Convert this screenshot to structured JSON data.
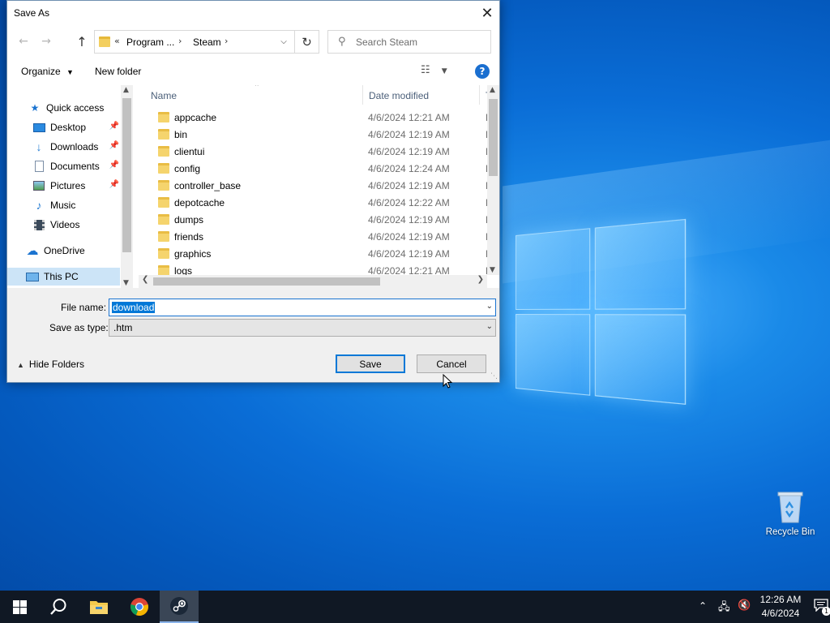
{
  "dialog": {
    "title": "Save As",
    "close_glyph": "✕",
    "address": {
      "overflow": "«",
      "crumbs": [
        "Program ...",
        "Steam"
      ]
    },
    "search": {
      "placeholder": "Search Steam"
    },
    "toolbar": {
      "organize": "Organize",
      "new_folder": "New folder",
      "help": "?"
    },
    "nav_pane": {
      "items": [
        {
          "label": "Quick access",
          "icon": "star-icon"
        },
        {
          "label": "Desktop",
          "icon": "desktop-icon",
          "pinned": true
        },
        {
          "label": "Downloads",
          "icon": "download-icon",
          "pinned": true
        },
        {
          "label": "Documents",
          "icon": "document-icon",
          "pinned": true
        },
        {
          "label": "Pictures",
          "icon": "picture-icon",
          "pinned": true
        },
        {
          "label": "Music",
          "icon": "music-icon"
        },
        {
          "label": "Videos",
          "icon": "video-icon"
        },
        {
          "label": "OneDrive",
          "icon": "cloud-icon"
        },
        {
          "label": "This PC",
          "icon": "computer-icon",
          "selected": true
        }
      ]
    },
    "file_list": {
      "columns": [
        "Name",
        "Date modified",
        "Ty"
      ],
      "rows": [
        {
          "name": "appcache",
          "date": "4/6/2024 12:21 AM",
          "type": "Fi"
        },
        {
          "name": "bin",
          "date": "4/6/2024 12:19 AM",
          "type": "Fi"
        },
        {
          "name": "clientui",
          "date": "4/6/2024 12:19 AM",
          "type": "Fi"
        },
        {
          "name": "config",
          "date": "4/6/2024 12:24 AM",
          "type": "Fi"
        },
        {
          "name": "controller_base",
          "date": "4/6/2024 12:19 AM",
          "type": "Fi"
        },
        {
          "name": "depotcache",
          "date": "4/6/2024 12:22 AM",
          "type": "Fi"
        },
        {
          "name": "dumps",
          "date": "4/6/2024 12:19 AM",
          "type": "Fi"
        },
        {
          "name": "friends",
          "date": "4/6/2024 12:19 AM",
          "type": "Fi"
        },
        {
          "name": "graphics",
          "date": "4/6/2024 12:19 AM",
          "type": "Fi"
        },
        {
          "name": "logs",
          "date": "4/6/2024 12:21 AM",
          "type": "Fi"
        }
      ]
    },
    "form": {
      "file_name_label": "File name:",
      "file_name_value": "download",
      "save_type_label": "Save as type:",
      "save_type_value": ".htm"
    },
    "hide_folders": "Hide Folders",
    "save": "Save",
    "cancel": "Cancel"
  },
  "desktop": {
    "recycle_bin": "Recycle Bin"
  },
  "taskbar": {
    "apps": [
      "start",
      "search",
      "file-explorer",
      "chrome",
      "steam"
    ],
    "active_app": "steam",
    "clock_time": "12:26 AM",
    "clock_date": "4/6/2024",
    "notification_count": "1"
  },
  "colors": {
    "accent": "#0078d7",
    "selection": "#cce4f7",
    "taskbar": "#101824"
  }
}
